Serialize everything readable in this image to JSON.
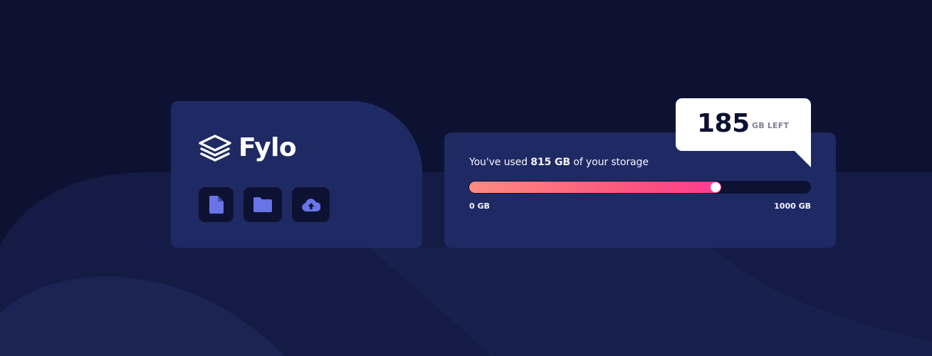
{
  "brand": {
    "name": "Fylo"
  },
  "toolbar": {
    "buttons": [
      {
        "icon": "document-icon"
      },
      {
        "icon": "folder-icon"
      },
      {
        "icon": "upload-cloud-icon"
      }
    ]
  },
  "storage": {
    "usage_prefix": "You've used ",
    "used_amount": "815 GB",
    "usage_suffix": " of your storage",
    "scale_min": "0 GB",
    "scale_max": "1000 GB",
    "used_fraction": 0.815,
    "remaining_number": "185",
    "remaining_unit": "GB LEFT"
  },
  "colors": {
    "background": "#0d1232",
    "card": "#1f2a64",
    "icon_tint": "#6874e8",
    "gradient_start": "#ff8b80",
    "gradient_end": "#ff3b94"
  }
}
